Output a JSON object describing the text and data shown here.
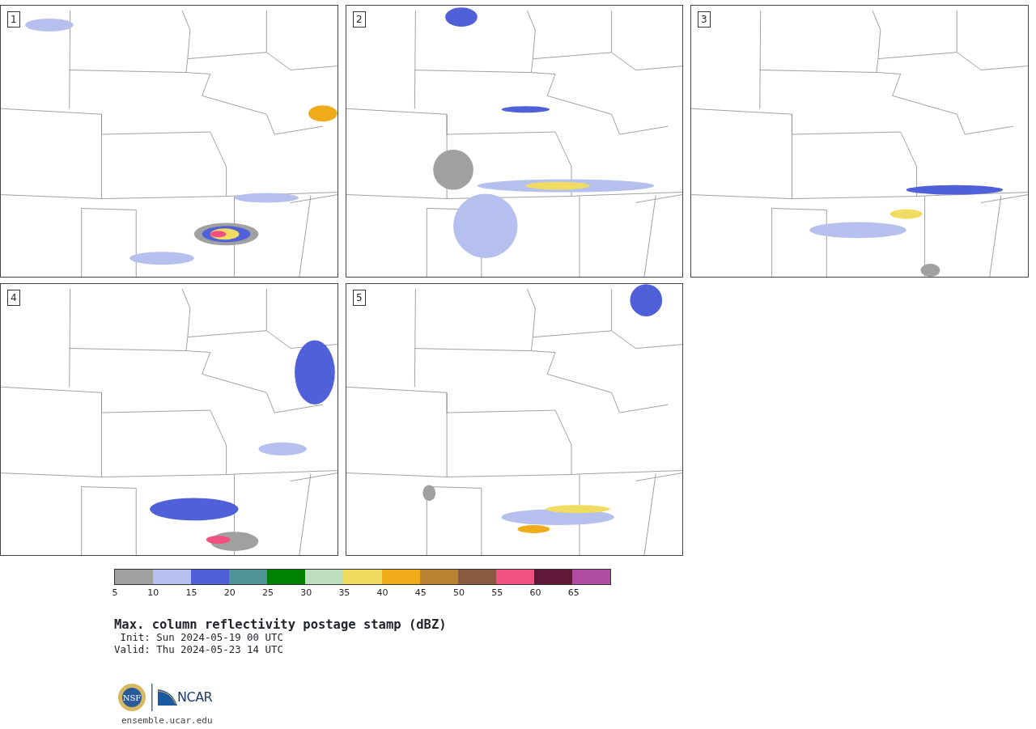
{
  "panels": [
    {
      "label": "1"
    },
    {
      "label": "2"
    },
    {
      "label": "3"
    },
    {
      "label": "4"
    },
    {
      "label": "5"
    }
  ],
  "colorbar": {
    "segments": [
      {
        "color": "#a0a0a0"
      },
      {
        "color": "#b5c0ee"
      },
      {
        "color": "#5060d8"
      },
      {
        "color": "#4f9598"
      },
      {
        "color": "#008000"
      },
      {
        "color": "#bedfbe"
      },
      {
        "color": "#f0dc60"
      },
      {
        "color": "#f0ac18"
      },
      {
        "color": "#ba8230"
      },
      {
        "color": "#8a5a40"
      },
      {
        "color": "#f25080"
      },
      {
        "color": "#601838"
      },
      {
        "color": "#b04ca4"
      }
    ],
    "ticks": [
      "5",
      "10",
      "15",
      "20",
      "25",
      "30",
      "35",
      "40",
      "45",
      "50",
      "55",
      "60",
      "65"
    ]
  },
  "title": "Max. column reflectivity postage stamp (dBZ)",
  "init": " Init: Sun 2024-05-19 00 UTC",
  "valid": "Valid: Thu 2024-05-23 14 UTC",
  "logos": {
    "nsf": "NSF",
    "ncar": "NCAR"
  },
  "url": "ensemble.ucar.edu"
}
